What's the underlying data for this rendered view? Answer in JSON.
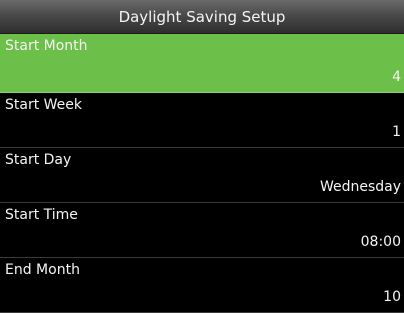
{
  "header": {
    "title": "Daylight Saving Setup"
  },
  "rows": [
    {
      "label": "Start Month",
      "value": "4",
      "selected": true
    },
    {
      "label": "Start Week",
      "value": "1"
    },
    {
      "label": "Start Day",
      "value": "Wednesday"
    },
    {
      "label": "Start Time",
      "value": "08:00"
    },
    {
      "label": "End Month",
      "value": "10"
    }
  ],
  "colors": {
    "selected_bg": "#6cc04a",
    "background": "#000000",
    "text": "#f4f4f4"
  }
}
